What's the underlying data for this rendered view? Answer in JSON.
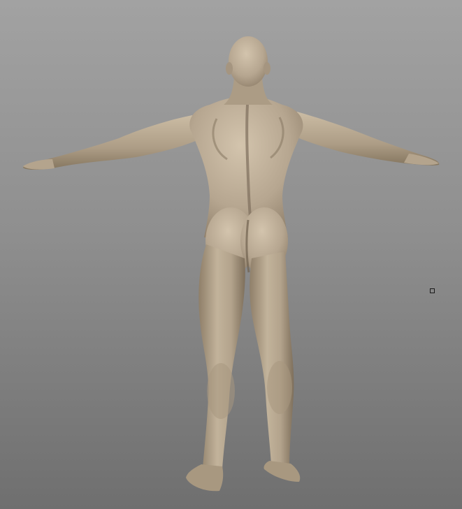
{
  "viewport": {
    "background_top": "#a2a2a2",
    "background_bottom": "#6f6f6f"
  },
  "model": {
    "pose": "T-pose",
    "view": "back",
    "skin_color": "#b6a690",
    "shadow_color": "#7d6e5c",
    "highlight_color": "#d6c8b2"
  },
  "pivot_marker": {
    "icon": "square-handle-icon"
  }
}
